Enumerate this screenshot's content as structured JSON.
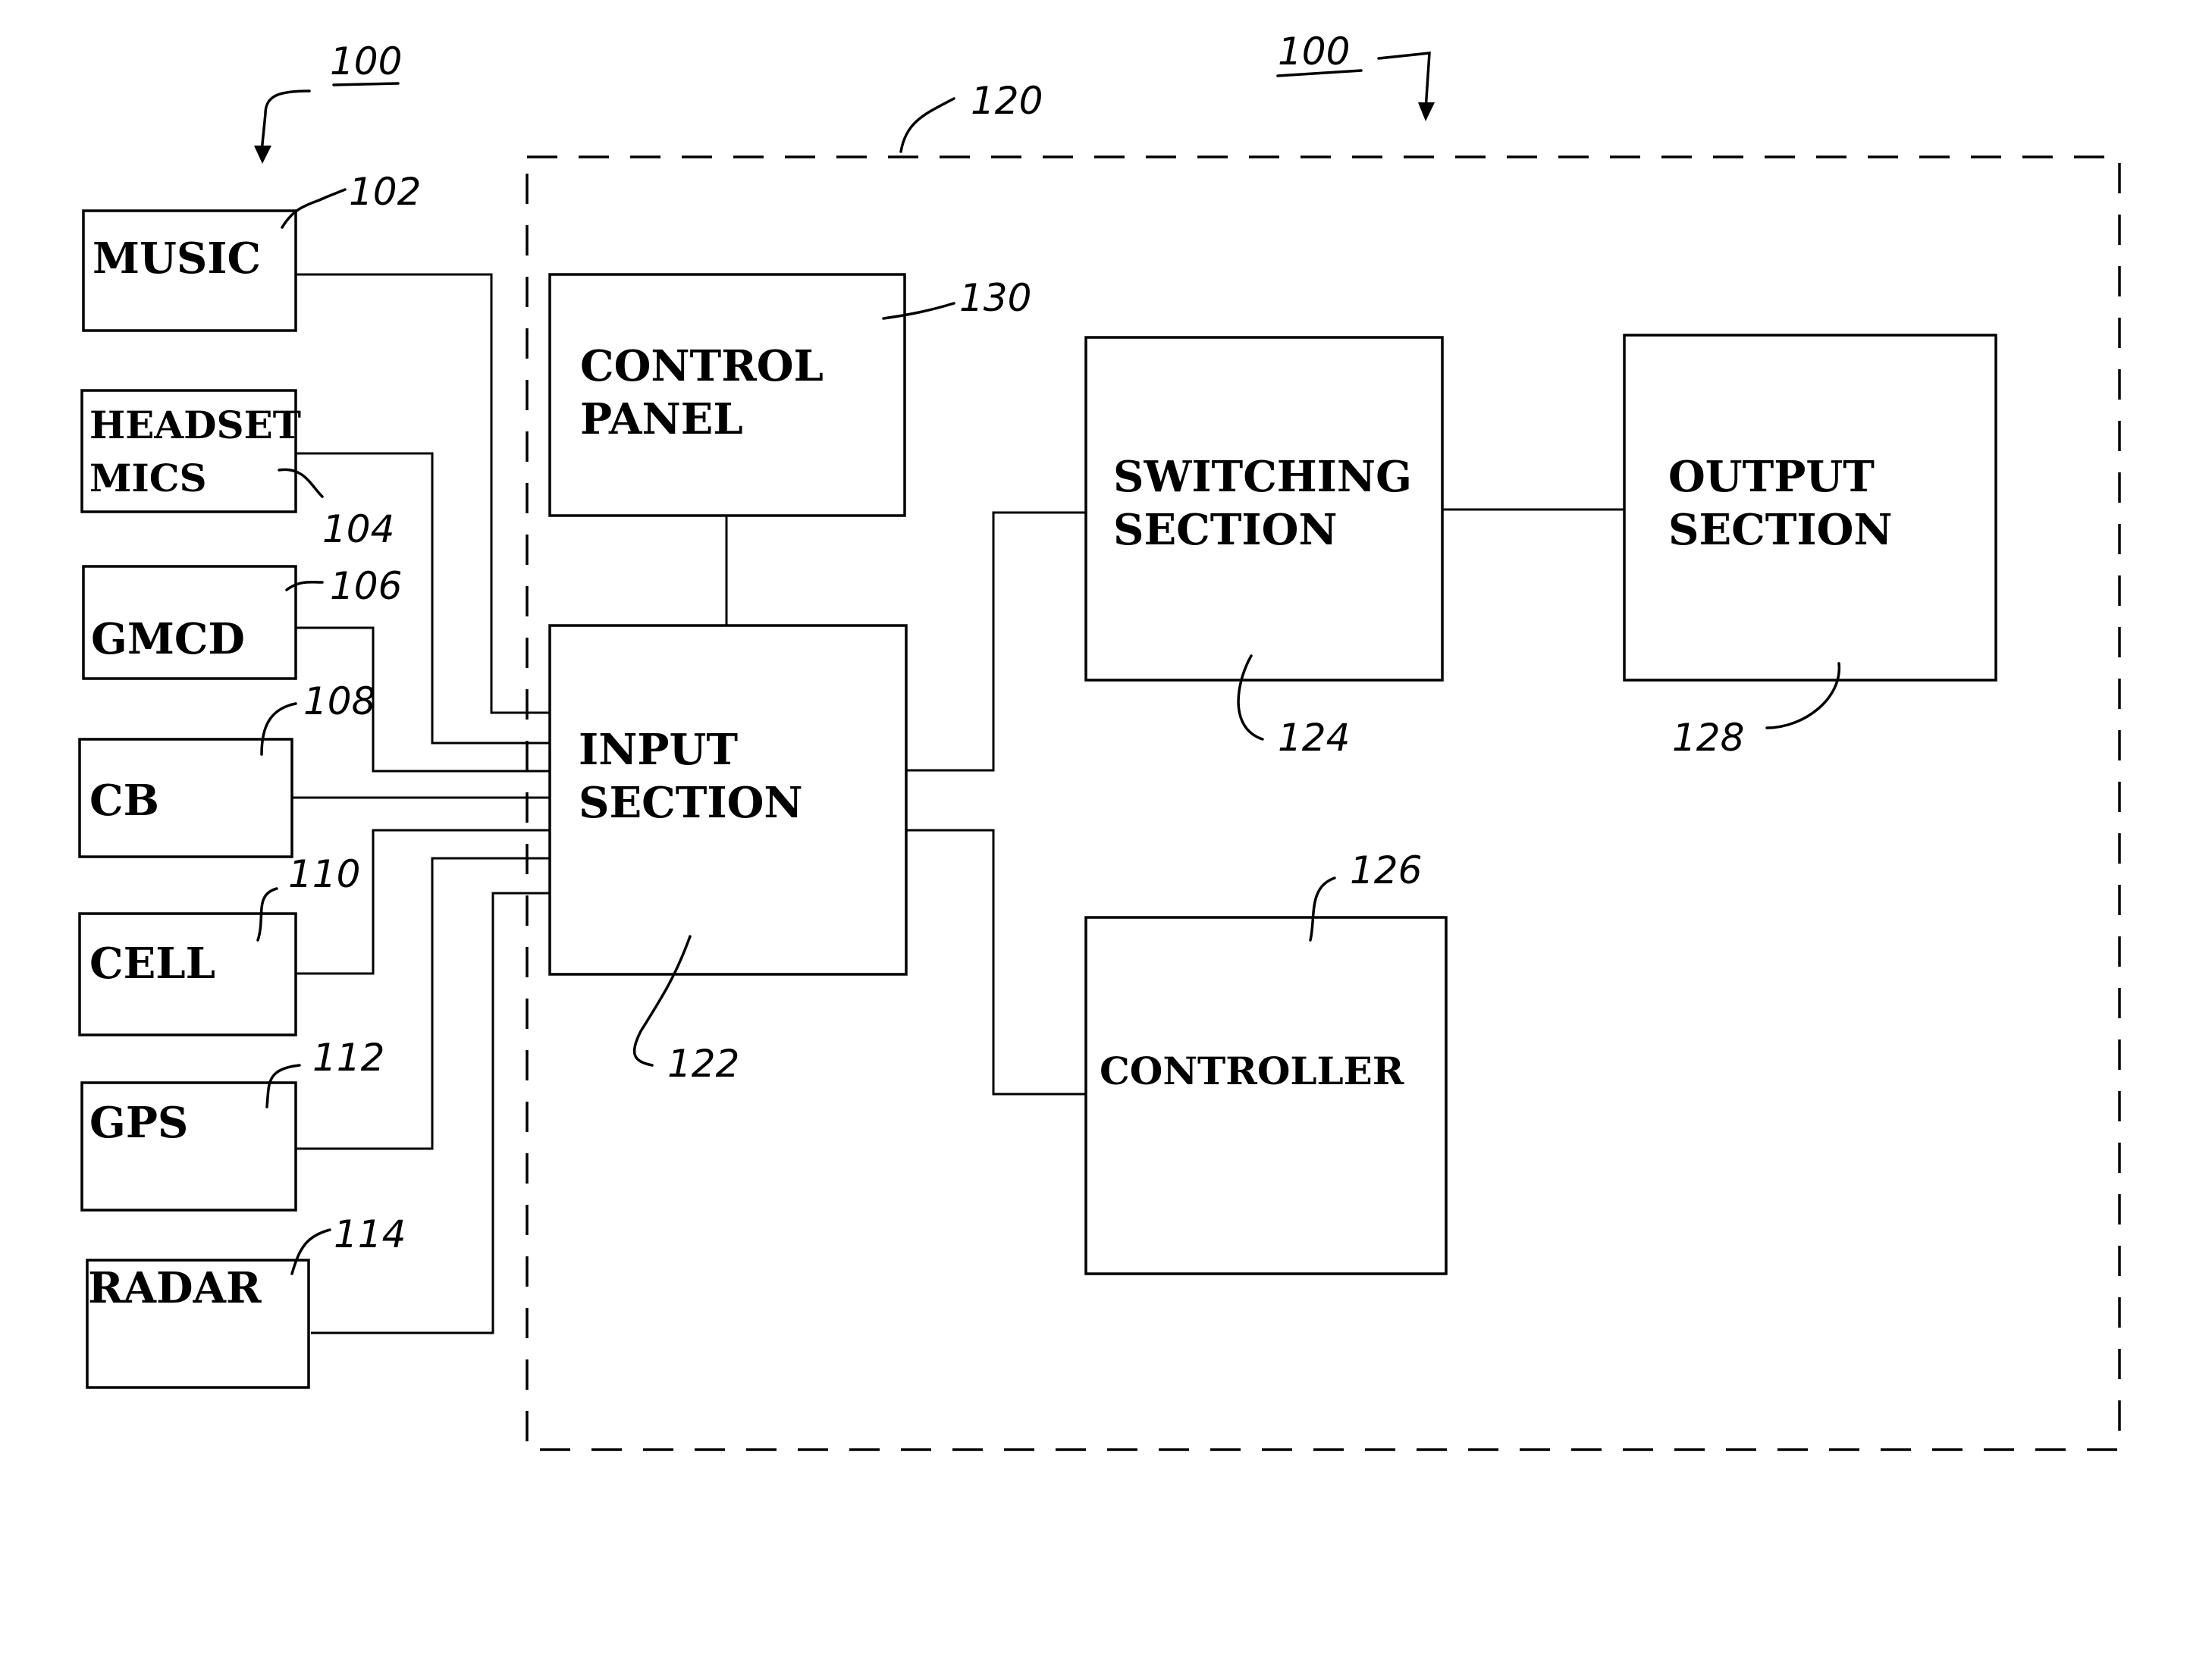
{
  "figure": {
    "overall_ref": "100",
    "system_ref": "100",
    "enclosure_ref": "120"
  },
  "sources": [
    {
      "id": "music",
      "label_lines": [
        "MUSIC"
      ],
      "ref": "102"
    },
    {
      "id": "headset-mics",
      "label_lines": [
        "HEADSET",
        "MICS"
      ],
      "ref": "104"
    },
    {
      "id": "gmcd",
      "label_lines": [
        "GMCD"
      ],
      "ref": "106"
    },
    {
      "id": "cb",
      "label_lines": [
        "CB"
      ],
      "ref": "108"
    },
    {
      "id": "cell",
      "label_lines": [
        "CELL"
      ],
      "ref": "110"
    },
    {
      "id": "gps",
      "label_lines": [
        "GPS"
      ],
      "ref": "112"
    },
    {
      "id": "radar",
      "label_lines": [
        "RADAR"
      ],
      "ref": "114"
    }
  ],
  "blocks": {
    "control_panel": {
      "label_lines": [
        "CONTROL",
        "PANEL"
      ],
      "ref": "130"
    },
    "input_section": {
      "label_lines": [
        "INPUT",
        "SECTION"
      ],
      "ref": "122"
    },
    "switching_section": {
      "label_lines": [
        "SWITCHING",
        "SECTION"
      ],
      "ref": "124"
    },
    "output_section": {
      "label_lines": [
        "OUTPUT",
        "SECTION"
      ],
      "ref": "128"
    },
    "controller": {
      "label_lines": [
        "CONTROLLER"
      ],
      "ref": "126"
    }
  }
}
